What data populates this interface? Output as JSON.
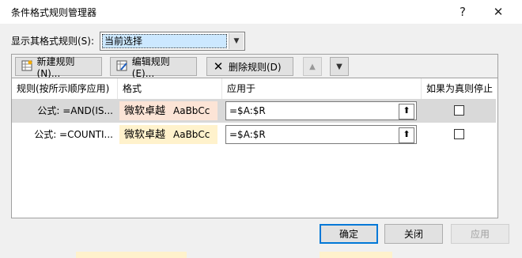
{
  "window": {
    "title": "条件格式规则管理器",
    "help_icon": "?",
    "close_icon": "✕"
  },
  "show_rules": {
    "label": "显示其格式规则(S):",
    "selected": "当前选择"
  },
  "toolbar": {
    "new_rule": "新建规则(N)...",
    "edit_rule": "编辑规则(E)...",
    "delete_rule": "删除规则(D)"
  },
  "table": {
    "headers": [
      "规则(按所示顺序应用)",
      "格式",
      "应用于",
      "如果为真则停止"
    ],
    "rows": [
      {
        "rule": "公式: =AND(IS...",
        "preview_zh": "微软卓越",
        "preview_en": "AaBbCc",
        "preview_bg": "#fce4d6",
        "applies_to": "=$A:$R",
        "selected": true
      },
      {
        "rule": "公式: =COUNTI...",
        "preview_zh": "微软卓越",
        "preview_en": "AaBbCc",
        "preview_bg": "#fff2cc",
        "applies_to": "=$A:$R",
        "selected": false
      }
    ]
  },
  "buttons": {
    "ok": "确定",
    "close": "关闭",
    "apply": "应用"
  },
  "colors": {
    "selection_row": "#d9d9d9",
    "combo_highlight": "#cce8ff",
    "default_button_border": "#0078d7"
  }
}
